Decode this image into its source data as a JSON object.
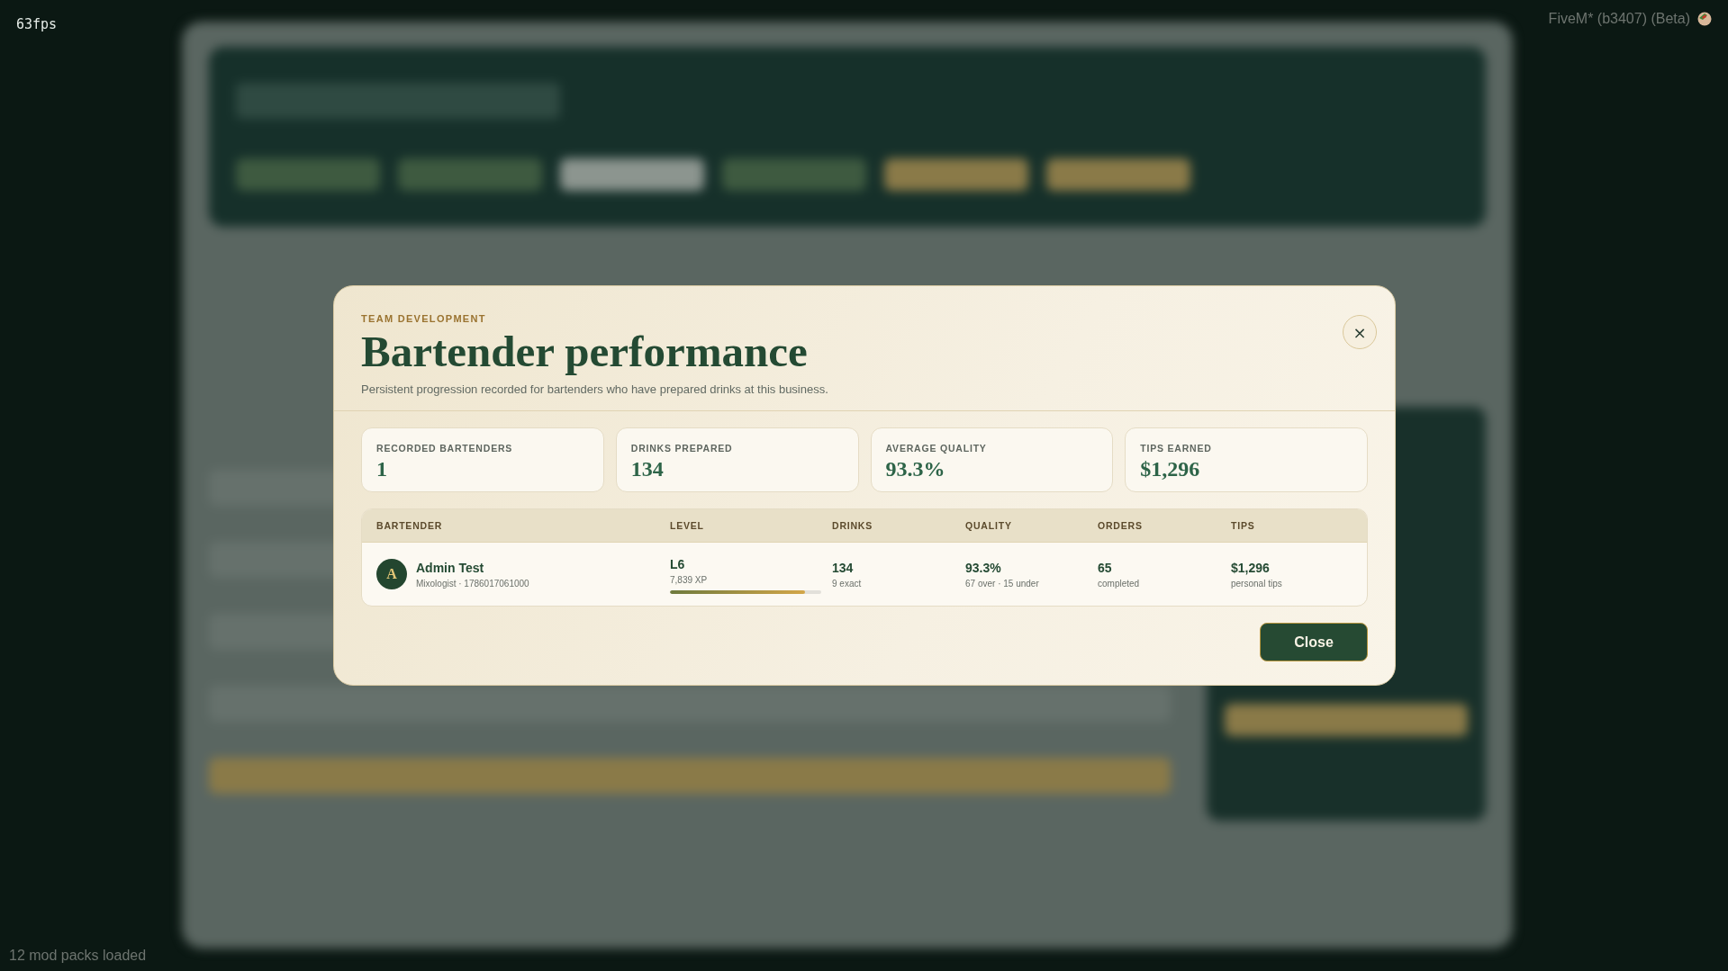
{
  "overlay": {
    "fps": "63fps",
    "build": "FiveM* (b3407) (Beta)",
    "status": "12 mod packs loaded"
  },
  "modal": {
    "eyebrow": "TEAM DEVELOPMENT",
    "title": "Bartender performance",
    "subtitle": "Persistent progression recorded for bartenders who have prepared drinks at this business.",
    "close_icon": "×",
    "stats": [
      {
        "label": "RECORDED BARTENDERS",
        "value": "1"
      },
      {
        "label": "DRINKS PREPARED",
        "value": "134"
      },
      {
        "label": "AVERAGE QUALITY",
        "value": "93.3%"
      },
      {
        "label": "TIPS EARNED",
        "value": "$1,296"
      }
    ],
    "table": {
      "columns": [
        "BARTENDER",
        "LEVEL",
        "DRINKS",
        "QUALITY",
        "ORDERS",
        "TIPS"
      ],
      "rows": [
        {
          "cells": [
            {
              "kind": "person",
              "avatar": "A",
              "value": "Admin Test",
              "note": "Mixologist · 1786017061000"
            },
            {
              "kind": "level",
              "value": "L6",
              "note": "7,839 XP",
              "level": 0.89
            },
            {
              "kind": "stat",
              "value": "134",
              "note": "9 exact"
            },
            {
              "kind": "stat",
              "value": "93.3%",
              "note": "67 over · 15 under"
            },
            {
              "kind": "stat",
              "value": "65",
              "note": "completed"
            },
            {
              "kind": "stat",
              "value": "$1,296",
              "note": "personal tips"
            }
          ]
        }
      ]
    },
    "buttons": [
      "Close"
    ]
  }
}
